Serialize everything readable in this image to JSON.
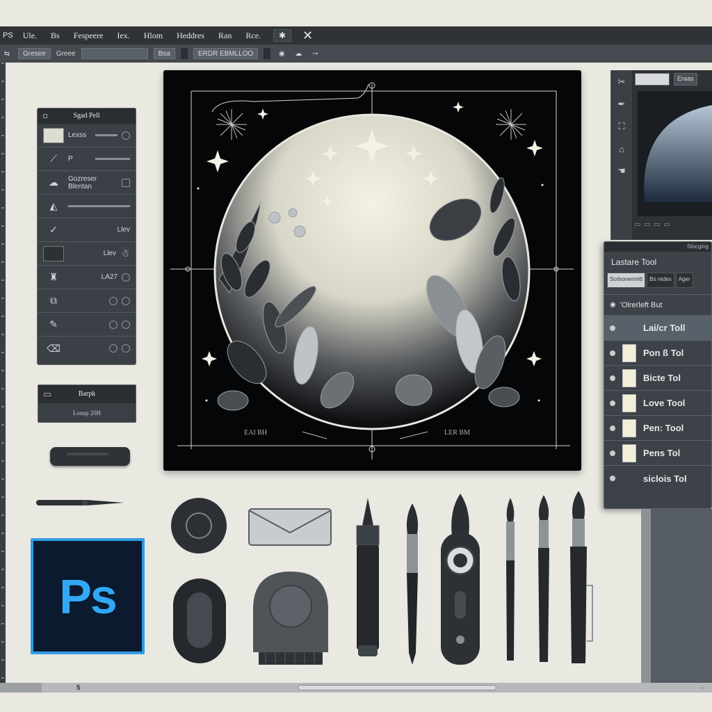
{
  "menubar": {
    "ps": "PS",
    "items": [
      "Ule.",
      "Bs",
      "Fespeere",
      "Iex.",
      "Hlom",
      "Heddres",
      "Ran",
      "Rce."
    ],
    "gear_icon": "gear-icon",
    "close_icon": "close-icon"
  },
  "optbar": {
    "items": [
      "Gresee",
      "Greee",
      "Bsa",
      "ERDR EBMLLOO"
    ]
  },
  "left_panel": {
    "title": "Sgad Pell",
    "rows": [
      {
        "label": "Lexss",
        "icon": "swatch"
      },
      {
        "label": "P",
        "icon": "curve-icon"
      },
      {
        "label": "Gozreser Blentan",
        "icon": "cloud-icon"
      },
      {
        "label": "",
        "icon": "triangle-icon"
      },
      {
        "label": "Llev",
        "icon": "check-icon"
      },
      {
        "label": "Llev",
        "icon": "swatch-dark"
      },
      {
        "label": "LA27",
        "icon": "paint-icon"
      },
      {
        "label": "",
        "icon": "copy-icon"
      },
      {
        "label": "",
        "icon": "brush-icon"
      },
      {
        "label": "",
        "icon": "eraser-icon"
      }
    ]
  },
  "barpk": {
    "title": "Barpk",
    "sub": "Lonsp 20H"
  },
  "logo": {
    "text": "Ps",
    "color": "#31a8f5"
  },
  "artboard": {
    "caption_left": "EAI BH",
    "caption_right": "LER BM"
  },
  "right_top": {
    "tab1": "",
    "tab2": "Eraas",
    "footer": [
      "",
      "",
      "",
      ""
    ]
  },
  "layers_panel": {
    "header": "Stocging",
    "title": "Lastare Tool",
    "tabs": [
      "Scrbonemnitt",
      "Bs redes",
      "Ager"
    ],
    "option": "'Olrerleft  But",
    "layers": [
      {
        "name": "Lai/cr Toll",
        "selected": true
      },
      {
        "name": "Pon ß Tol"
      },
      {
        "name": "Bicte Tol"
      },
      {
        "name": "Love Tool"
      },
      {
        "name": "Pen: Tool"
      },
      {
        "name": "Pens Tol"
      },
      {
        "name": "siclois Tol"
      }
    ]
  },
  "status": {
    "left": "",
    "page": "5"
  },
  "colors": {
    "accent": "#31a8f5",
    "panel": "#3b4046",
    "canvas_bg": "#e9e8e1"
  }
}
